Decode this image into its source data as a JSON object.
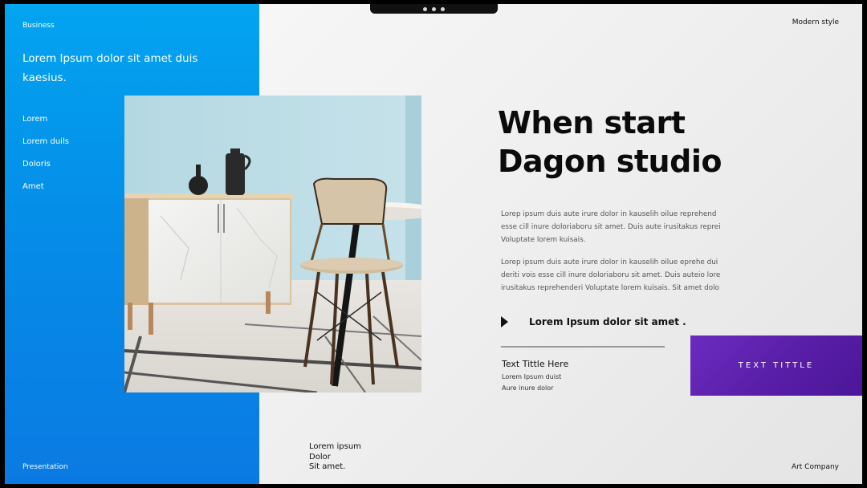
{
  "left_panel": {
    "category": "Business",
    "heading": "Lorem Ipsum dolor sit amet duis kaesius.",
    "menu": [
      "Lorem",
      "Lorem duils",
      "Doloris",
      "Amet"
    ],
    "footer": "Presentation"
  },
  "top_right_label": "Modern style",
  "headline": {
    "line1": "When start",
    "line2": "Dagon studio"
  },
  "paragraphs": [
    "Lorep  ipsum duis aute irure dolor in kauselih oilue reprehend esse cill inure doloriaboru sit amet. Duis aute irusitakus reprei Voluptate lorem kuisais.",
    "Lorep  ipsum duis aute irure dolor in kauselih oilue eprehe dui deriti vois esse cill inure doloriaboru sit amet. Duis auteio lore irusitakus reprehenderi Voluptate lorem kuisais. Sit amet dolo"
  ],
  "bullet": "Lorem Ipsum dolor sit amet .",
  "sub": {
    "title": "Text Tittle Here",
    "line1": "Lorem Ipsum  duist",
    "line2": "Aure inure dolor"
  },
  "cta_label": "TEXT TITTLE",
  "bottom_note": [
    "Lorem ipsum",
    "Dolor",
    "Sit amet."
  ],
  "bottom_right_label": "Art Company",
  "colors": {
    "blue_panel": "#058de8",
    "purple_cta": "#5a1fa8",
    "text_dark": "#0b0b0b"
  }
}
